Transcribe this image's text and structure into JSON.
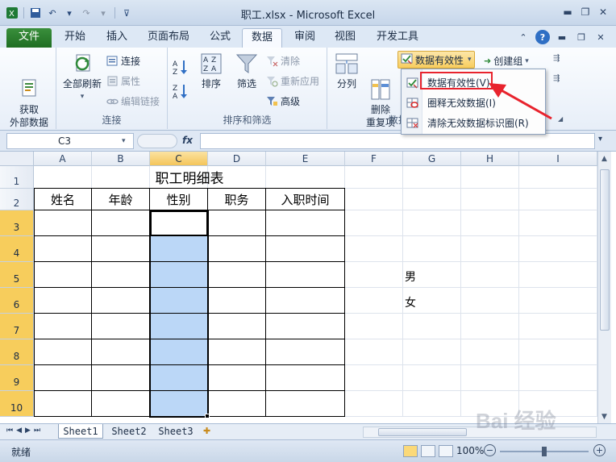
{
  "window": {
    "title": "职工.xlsx - Microsoft Excel"
  },
  "tabs": [
    "文件",
    "开始",
    "插入",
    "页面布局",
    "公式",
    "数据",
    "审阅",
    "视图",
    "开发工具"
  ],
  "ribbon": {
    "get_external": "获取\n外部数据",
    "refresh_all": "全部刷新",
    "connections": "连接",
    "properties": "属性",
    "edit_links": "编辑链接",
    "group_connections": "连接",
    "sort": "排序",
    "filter": "筛选",
    "clear": "清除",
    "reapply": "重新应用",
    "advanced": "高级",
    "group_sort_filter": "排序和筛选",
    "text_to_columns": "分列",
    "remove_dup": "删除\n重复项",
    "data_validation": "数据有效性",
    "group_data_tools": "数据",
    "group": "创建组"
  },
  "menu": {
    "items": [
      "数据有效性(V)...",
      "圈释无效数据(I)",
      "清除无效数据标识圈(R)"
    ]
  },
  "formula_bar": {
    "name_box": "C3",
    "fx": "fx",
    "value": ""
  },
  "columns": [
    "A",
    "B",
    "C",
    "D",
    "E",
    "F",
    "G",
    "H",
    "I"
  ],
  "rows": [
    "1",
    "2",
    "3",
    "4",
    "5",
    "6",
    "7",
    "8",
    "9",
    "10"
  ],
  "sheet": {
    "title": "职工明细表",
    "headers": [
      "姓名",
      "年龄",
      "性别",
      "职务",
      "入职时间"
    ],
    "g5": "男",
    "g6": "女"
  },
  "sheet_tabs": [
    "Sheet1",
    "Sheet2",
    "Sheet3"
  ],
  "status": {
    "text": "就绪",
    "zoom": "100%"
  },
  "watermark": "Bai 经验"
}
